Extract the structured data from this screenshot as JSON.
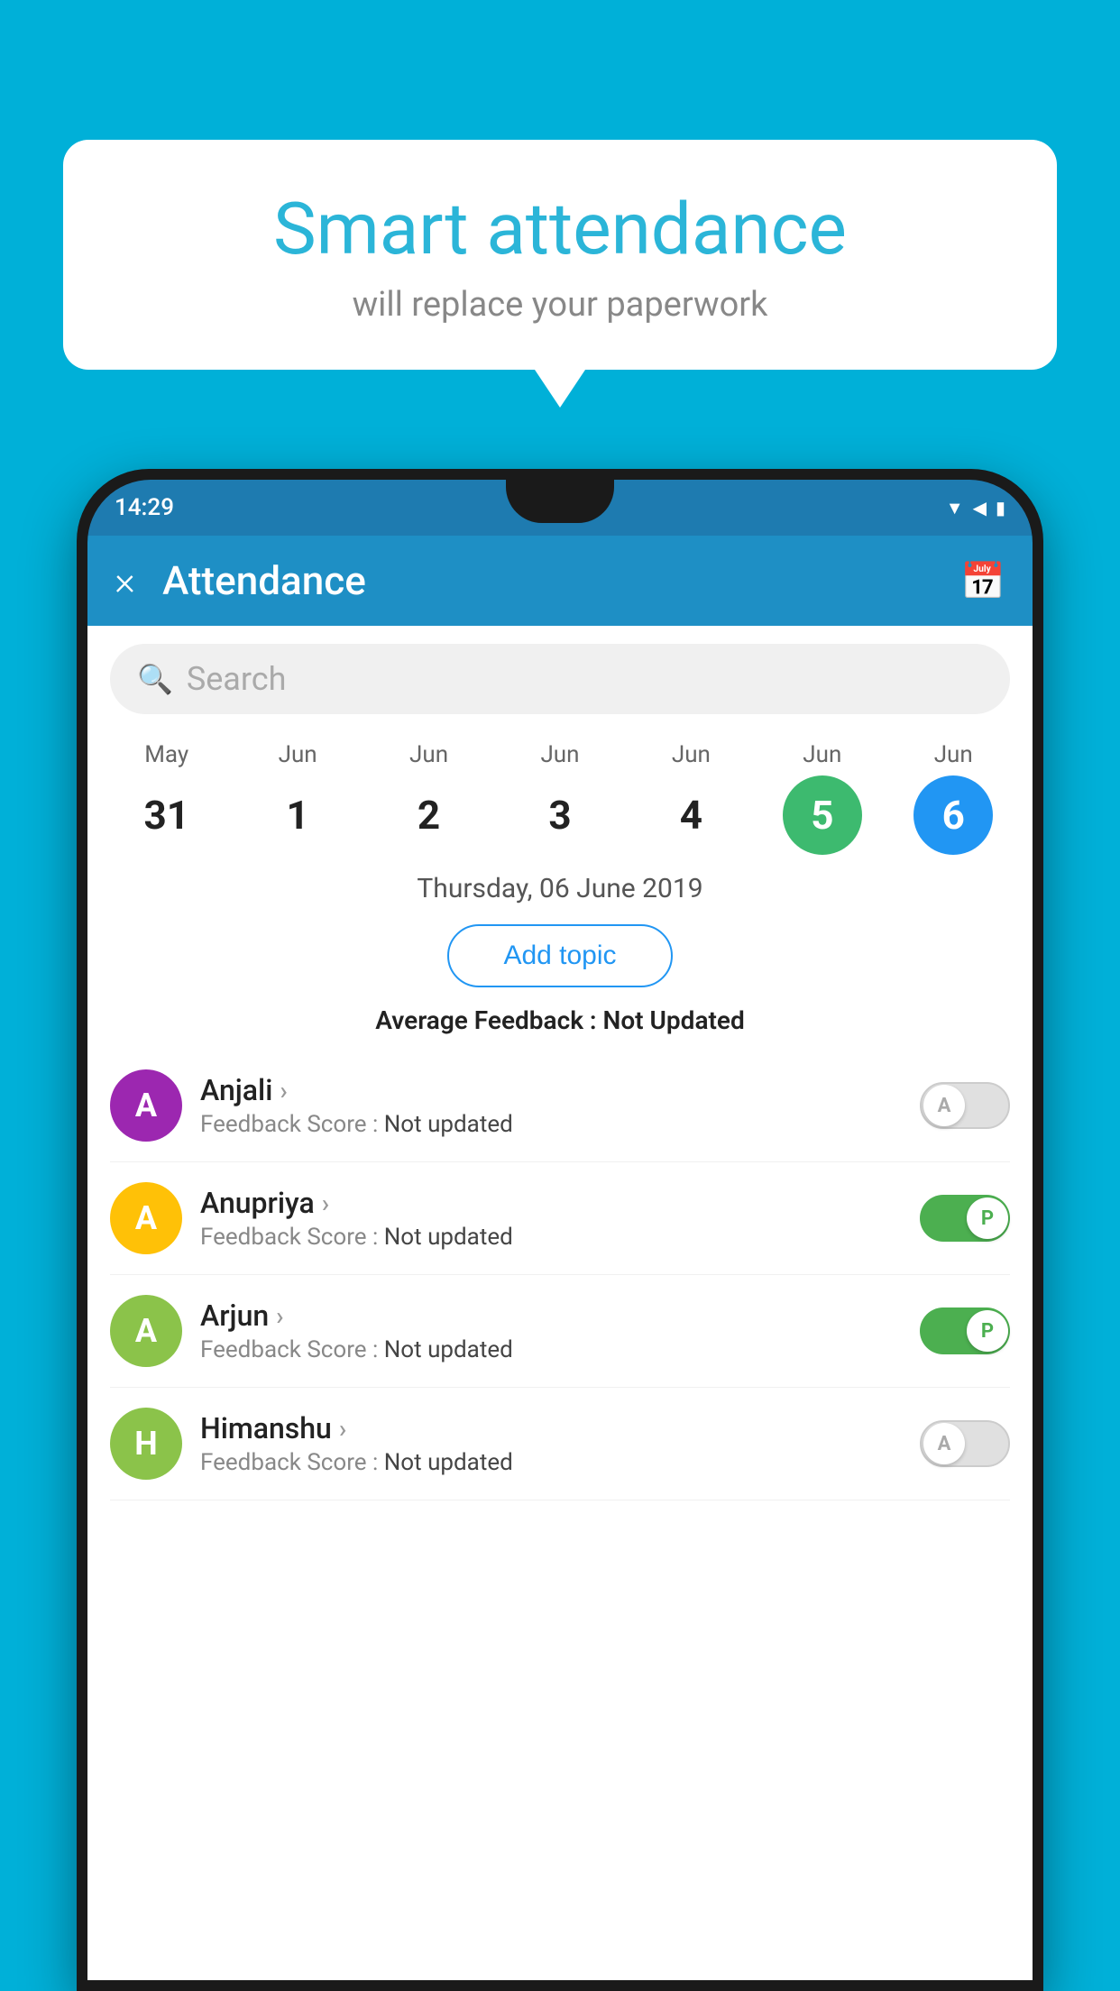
{
  "background_color": "#00b0d8",
  "speech_bubble": {
    "title": "Smart attendance",
    "subtitle": "will replace your paperwork"
  },
  "status_bar": {
    "time": "14:29",
    "wifi_icon": "wifi",
    "signal_icon": "signal",
    "battery_icon": "battery"
  },
  "app_bar": {
    "close_label": "×",
    "title": "Attendance",
    "calendar_icon": "📅"
  },
  "search": {
    "placeholder": "Search"
  },
  "calendar": {
    "days": [
      {
        "month": "May",
        "num": "31",
        "state": "normal"
      },
      {
        "month": "Jun",
        "num": "1",
        "state": "normal"
      },
      {
        "month": "Jun",
        "num": "2",
        "state": "normal"
      },
      {
        "month": "Jun",
        "num": "3",
        "state": "normal"
      },
      {
        "month": "Jun",
        "num": "4",
        "state": "normal"
      },
      {
        "month": "Jun",
        "num": "5",
        "state": "today"
      },
      {
        "month": "Jun",
        "num": "6",
        "state": "selected"
      }
    ]
  },
  "selected_date": "Thursday, 06 June 2019",
  "add_topic_label": "Add topic",
  "avg_feedback_label": "Average Feedback :",
  "avg_feedback_value": "Not Updated",
  "students": [
    {
      "name": "Anjali",
      "avatar_letter": "A",
      "avatar_color": "#9c27b0",
      "feedback_label": "Feedback Score :",
      "feedback_value": "Not updated",
      "toggle": "off",
      "toggle_label": "A"
    },
    {
      "name": "Anupriya",
      "avatar_letter": "A",
      "avatar_color": "#ffc107",
      "feedback_label": "Feedback Score :",
      "feedback_value": "Not updated",
      "toggle": "on",
      "toggle_label": "P"
    },
    {
      "name": "Arjun",
      "avatar_letter": "A",
      "avatar_color": "#8bc34a",
      "feedback_label": "Feedback Score :",
      "feedback_value": "Not updated",
      "toggle": "on",
      "toggle_label": "P"
    },
    {
      "name": "Himanshu",
      "avatar_letter": "H",
      "avatar_color": "#8bc34a",
      "feedback_label": "Feedback Score :",
      "feedback_value": "Not updated",
      "toggle": "off",
      "toggle_label": "A"
    }
  ]
}
